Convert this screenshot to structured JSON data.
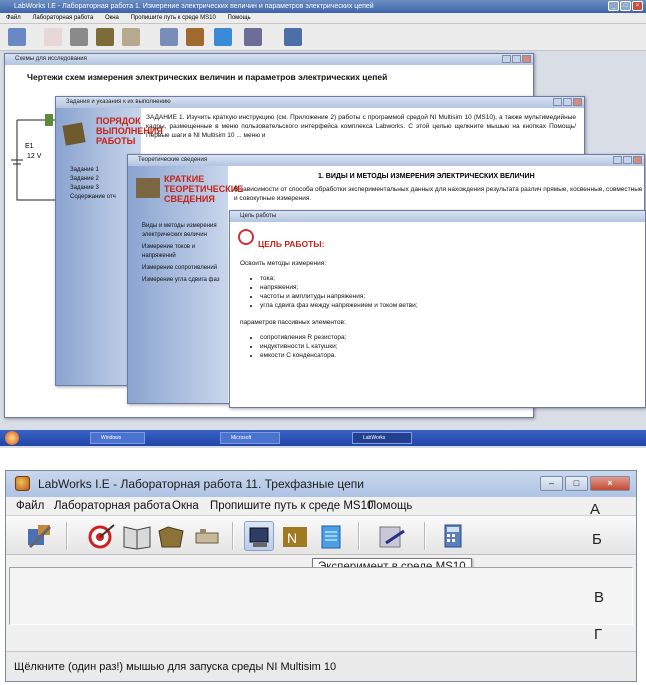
{
  "top": {
    "main_title": "LabWorks I.E - Лабораторная работа 1. Измерение электрических величин и параметров электрических цепей",
    "menu": [
      "Файл",
      "Лабораторная работа",
      "Окна",
      "Пропишите путь к среде MS10",
      "Помощь"
    ],
    "win1": {
      "title": "Схемы для исследования",
      "heading": "Чертежи схем измерения электрических величин и параметров электрических цепей",
      "schematic_labels": [
        "E1",
        "12 V"
      ]
    },
    "win2": {
      "title": "Задания и указания к их выполнению",
      "side_title": "ПОРЯДОК ВЫПОЛНЕНИЯ РАБОТЫ",
      "items": [
        "Задание 1",
        "Задание 2",
        "Задание 3",
        "Содержание отч"
      ],
      "body": "ЗАДАНИЕ 1. Изучить краткую инструкцию (см. Приложение 2) работы с программой средой NI Multisim 10 (MS10), а также мультимедийные кадры, размещенные в меню пользовательского интерфейса комплекса Labworks. С этой целью щелкните мышью на кнопках Помощь/Первые шаги в NI Multisim 10 ... меню и"
    },
    "win3": {
      "title": "Теоретические сведения",
      "side_title": "КРАТКИЕ ТЕОРЕТИЧЕСКИЕ СВЕДЕНИЯ",
      "items": [
        "Виды и методы измерения электрических величин",
        "Измерение токов и напряжений",
        "Измерение сопротивлений",
        "Измерение угла сдвига фаз"
      ],
      "heading": "1. ВИДЫ И МЕТОДЫ ИЗМЕРЕНИЯ ЭЛЕКТРИЧЕСКИХ ВЕЛИЧИН",
      "body": "В зависимости от способа обработки экспериментальных данных для нахождения результата различ прямые, косвенные, совместные и совокупные измерения."
    },
    "win4": {
      "title": "Цель работы",
      "heading": "ЦЕЛЬ РАБОТЫ:",
      "intro": "Освоить методы измерения:",
      "list1": [
        "тока;",
        "напряжения;",
        "частоты и амплитуды напряжения;",
        "угла сдвига фаз между напряжением и током ветви;"
      ],
      "intro2": "параметров пассивных элементов:",
      "list2": [
        "сопротивления R резистора;",
        "индуктивности L катушки;",
        "емкости С конденсатора."
      ]
    },
    "taskbar": [
      "Windows",
      "Microsoft",
      "LabWorks"
    ]
  },
  "bottom": {
    "title": "LabWorks I.E - Лабораторная работа 11. Трехфазные цепи",
    "menu": [
      "Файл",
      "Лабораторная работа",
      "Окна",
      "Пропишите путь к среде MS10",
      "Помощь"
    ],
    "tooltip": "Эксперимент в среде MS10",
    "status": "Щёлкните (один раз!) мышью для запуска среды NI Multisim 10",
    "letters": [
      "А",
      "Б",
      "В",
      "Г"
    ]
  }
}
